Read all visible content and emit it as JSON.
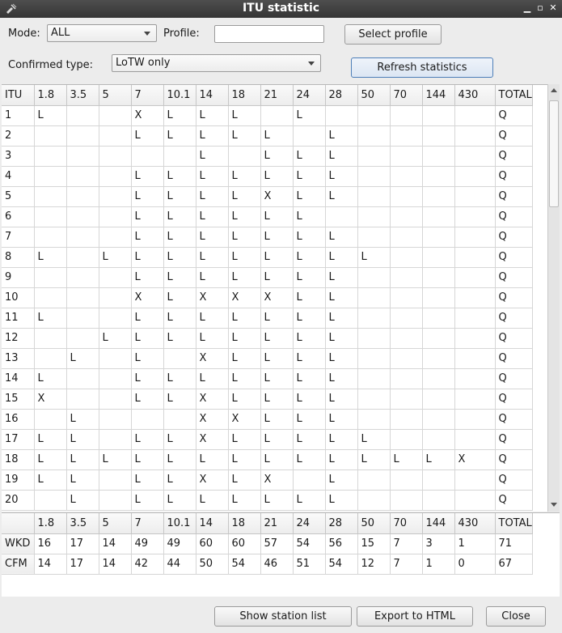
{
  "window": {
    "title": "ITU statistic"
  },
  "controls": {
    "mode_label": "Mode:",
    "mode_value": "ALL",
    "profile_label": "Profile:",
    "profile_value": "",
    "select_profile_label": "Select profile",
    "confirmed_label": "Confirmed type:",
    "confirmed_value": "LoTW only",
    "refresh_label": "Refresh statistics"
  },
  "grid": {
    "headers": [
      "ITU",
      "1.8",
      "3.5",
      "5",
      "7",
      "10.1",
      "14",
      "18",
      "21",
      "24",
      "28",
      "50",
      "70",
      "144",
      "430",
      "TOTAL"
    ],
    "rows": [
      [
        "1",
        "L",
        "",
        "",
        "X",
        "L",
        "L",
        "L",
        "",
        "L",
        "",
        "",
        "",
        "",
        "",
        "Q"
      ],
      [
        "2",
        "",
        "",
        "",
        "L",
        "L",
        "L",
        "L",
        "L",
        "",
        "L",
        "",
        "",
        "",
        "",
        "Q"
      ],
      [
        "3",
        "",
        "",
        "",
        "",
        "",
        "L",
        "",
        "L",
        "L",
        "L",
        "",
        "",
        "",
        "",
        "Q"
      ],
      [
        "4",
        "",
        "",
        "",
        "L",
        "L",
        "L",
        "L",
        "L",
        "L",
        "L",
        "",
        "",
        "",
        "",
        "Q"
      ],
      [
        "5",
        "",
        "",
        "",
        "L",
        "L",
        "L",
        "L",
        "X",
        "L",
        "L",
        "",
        "",
        "",
        "",
        "Q"
      ],
      [
        "6",
        "",
        "",
        "",
        "L",
        "L",
        "L",
        "L",
        "L",
        "L",
        "",
        "",
        "",
        "",
        "",
        "Q"
      ],
      [
        "7",
        "",
        "",
        "",
        "L",
        "L",
        "L",
        "L",
        "L",
        "L",
        "L",
        "",
        "",
        "",
        "",
        "Q"
      ],
      [
        "8",
        "L",
        "",
        "L",
        "L",
        "L",
        "L",
        "L",
        "L",
        "L",
        "L",
        "L",
        "",
        "",
        "",
        "Q"
      ],
      [
        "9",
        "",
        "",
        "",
        "L",
        "L",
        "L",
        "L",
        "L",
        "L",
        "L",
        "",
        "",
        "",
        "",
        "Q"
      ],
      [
        "10",
        "",
        "",
        "",
        "X",
        "L",
        "X",
        "X",
        "X",
        "L",
        "L",
        "",
        "",
        "",
        "",
        "Q"
      ],
      [
        "11",
        "L",
        "",
        "",
        "L",
        "L",
        "L",
        "L",
        "L",
        "L",
        "L",
        "",
        "",
        "",
        "",
        "Q"
      ],
      [
        "12",
        "",
        "",
        "L",
        "L",
        "L",
        "L",
        "L",
        "L",
        "L",
        "L",
        "",
        "",
        "",
        "",
        "Q"
      ],
      [
        "13",
        "",
        "L",
        "",
        "L",
        "",
        "X",
        "L",
        "L",
        "L",
        "L",
        "",
        "",
        "",
        "",
        "Q"
      ],
      [
        "14",
        "L",
        "",
        "",
        "L",
        "L",
        "L",
        "L",
        "L",
        "L",
        "L",
        "",
        "",
        "",
        "",
        "Q"
      ],
      [
        "15",
        "X",
        "",
        "",
        "L",
        "L",
        "X",
        "L",
        "L",
        "L",
        "L",
        "",
        "",
        "",
        "",
        "Q"
      ],
      [
        "16",
        "",
        "L",
        "",
        "",
        "",
        "X",
        "X",
        "L",
        "L",
        "L",
        "",
        "",
        "",
        "",
        "Q"
      ],
      [
        "17",
        "L",
        "L",
        "",
        "L",
        "L",
        "X",
        "L",
        "L",
        "L",
        "L",
        "L",
        "",
        "",
        "",
        "Q"
      ],
      [
        "18",
        "L",
        "L",
        "L",
        "L",
        "L",
        "L",
        "L",
        "L",
        "L",
        "L",
        "L",
        "L",
        "L",
        "X",
        "Q"
      ],
      [
        "19",
        "L",
        "L",
        "",
        "L",
        "L",
        "X",
        "L",
        "X",
        "",
        "L",
        "",
        "",
        "",
        "",
        "Q"
      ],
      [
        "20",
        "",
        "L",
        "",
        "L",
        "L",
        "L",
        "L",
        "L",
        "L",
        "L",
        "",
        "",
        "",
        "",
        "Q"
      ]
    ]
  },
  "summary": {
    "headers": [
      "",
      "1.8",
      "3.5",
      "5",
      "7",
      "10.1",
      "14",
      "18",
      "21",
      "24",
      "28",
      "50",
      "70",
      "144",
      "430",
      "TOTAL"
    ],
    "rows": [
      [
        "WKD",
        "16",
        "17",
        "14",
        "49",
        "49",
        "60",
        "60",
        "57",
        "54",
        "56",
        "15",
        "7",
        "3",
        "1",
        "71"
      ],
      [
        "CFM",
        "14",
        "17",
        "14",
        "42",
        "44",
        "50",
        "54",
        "46",
        "51",
        "54",
        "12",
        "7",
        "1",
        "0",
        "67"
      ]
    ]
  },
  "buttons": {
    "station_list": "Show station list",
    "export_html": "Export to HTML",
    "close": "Close"
  }
}
